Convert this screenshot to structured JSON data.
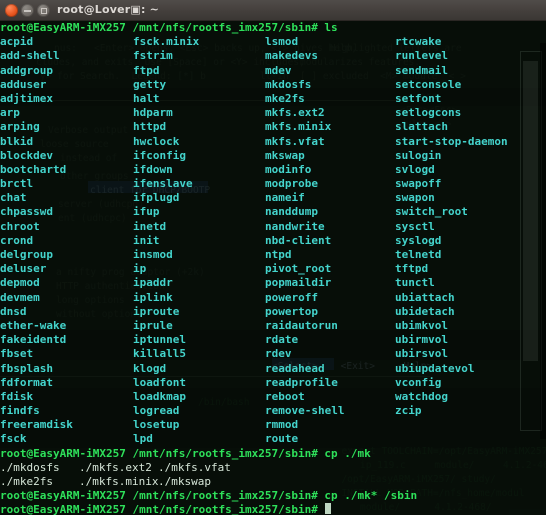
{
  "window": {
    "title": "root@Lover▣: ~",
    "controls": [
      {
        "name": "close",
        "label": "Close"
      },
      {
        "name": "minimize",
        "label": "Minimize"
      },
      {
        "name": "maximize",
        "label": "Maximize"
      }
    ]
  },
  "colors": {
    "prompt_green": "#2ee05a",
    "file_cyan": "#44d4cc",
    "plain": "#d6e6d8",
    "titlebar": "#443f3c",
    "background": "#060e08",
    "close_button": "#e8561f"
  },
  "terminal": {
    "prompt": "root@EasyARM-iMX257 /mnt/nfs/rootfs_imx257/sbin#",
    "command_ls": " ls",
    "command_cp_partial": " cp ./mk",
    "command_cp_full": " cp ./mk* /sbin",
    "cursor": "block-cursor",
    "ls_columns": [
      [
        "acpid",
        "add-shell",
        "addgroup",
        "adduser",
        "adjtimex",
        "arp",
        "arping",
        "blkid",
        "blockdev",
        "bootchartd",
        "brctl",
        "chat",
        "chpasswd",
        "chroot",
        "crond",
        "delgroup",
        "deluser",
        "depmod",
        "devmem",
        "dnsd",
        "ether-wake",
        "fakeidentd",
        "fbset",
        "fbsplash",
        "fdformat",
        "fdisk",
        "findfs",
        "freeramdisk",
        "fsck"
      ],
      [
        "fsck.minix",
        "fstrim",
        "ftpd",
        "getty",
        "halt",
        "hdparm",
        "httpd",
        "hwclock",
        "ifconfig",
        "ifdown",
        "ifenslave",
        "ifplugd",
        "ifup",
        "inetd",
        "init",
        "insmod",
        "ip",
        "ipaddr",
        "iplink",
        "iproute",
        "iprule",
        "iptunnel",
        "killall5",
        "klogd",
        "loadfont",
        "loadkmap",
        "logread",
        "losetup",
        "lpd"
      ],
      [
        "lsmod",
        "makedevs",
        "mdev",
        "mkdosfs",
        "mke2fs",
        "mkfs.ext2",
        "mkfs.minix",
        "mkfs.vfat",
        "mkswap",
        "modinfo",
        "modprobe",
        "nameif",
        "nanddump",
        "nandwrite",
        "nbd-client",
        "ntpd",
        "pivot_root",
        "popmaildir",
        "poweroff",
        "powertop",
        "raidautorun",
        "rdate",
        "rdev",
        "readahead",
        "readprofile",
        "reboot",
        "remove-shell",
        "rmmod",
        "route"
      ],
      [
        "rtcwake",
        "runlevel",
        "sendmail",
        "setconsole",
        "setfont",
        "setlogcons",
        "slattach",
        "start-stop-daemon",
        "sulogin",
        "svlogd",
        "swapoff",
        "swapon",
        "switch_root",
        "sysctl",
        "syslogd",
        "telnetd",
        "tftpd",
        "tunctl",
        "ubiattach",
        "ubidetach",
        "ubimkvol",
        "ubirmvol",
        "ubirsvol",
        "ubiupdatevol",
        "vconfig",
        "watchdog",
        "zcip"
      ]
    ],
    "completion_rows": [
      [
        "./mkdosfs",
        "./mkfs.ext2",
        "./mkfs.vfat"
      ],
      [
        "./mke2fs",
        "./mkfs.minix",
        "./mkswap"
      ]
    ]
  },
  "background_ghost": {
    "lines": [
      "        nus:   <Enter> opens, <Esc> backs up, <?> gives help, </> searches,",
      "  includes, and exits. Use [Space] or <Y> includes, <N> excludes, <M> modularizes",
      "  y> for Search. Legend: [*] built-in  [ ] excluded  <M> module  < > module capable",
      "",
      "",
      "   Verbose output                                                    ─────",
      "  loose source                                                        ",
      "     instead of                                                       ",
      "",
      "         Other groups                                                 ",
      "  client for DHCP/BOOTP                                               ",
      "  server (udhcpd)                                                     ",
      "  ent (udhcpc)                                                        ",
      "",
      "",
      " a nifty prog adaptor (+2k)                                           ",
      "  HTTP authentication                                                 ",
      "  long options                                                        ",
      "  without options                                                     ",
      "",
      "",
      "",
      "",
      "",
      "",
      "",
      "      <Select>    <Exit>    <Help>                                    ",
      "",
      ""
    ],
    "bottom_lines": [
      "  export TOOLCHAIN=/opt/EasyARM-iMX257/4.1.2/arm-none-linux",
      "  ARCH=arm CROSS_COMPILE=arm-none-linux-gnueabi-",
      "  make modules_install INSTALL_MOD_PATH=/mnt/nfs/rootfs_imx257/study/",
      "  ip-119.c          module/        4.1.2-468/",
      "  /opt/EasyARM-iMX257/ study/",
      "  make INSTALL_MOD_PATH=/mnt/nfs/rootfs_imx257/nfs_home/module",
      "  module/          4.1.2-468/"
    ]
  }
}
